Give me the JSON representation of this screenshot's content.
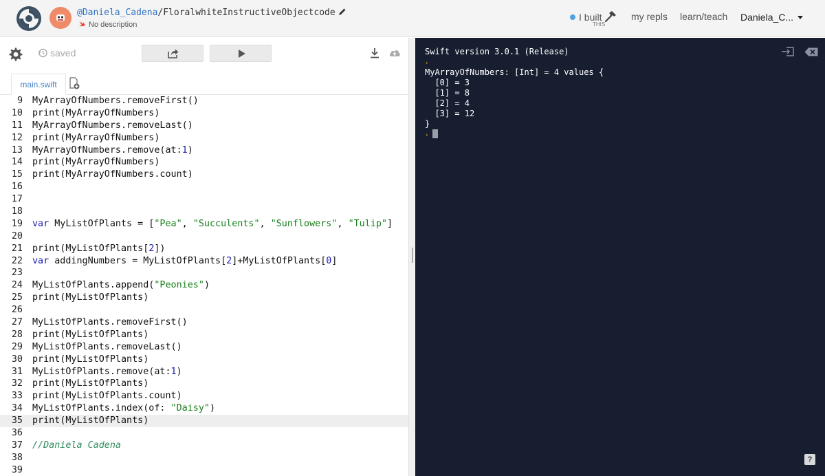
{
  "header": {
    "username": "@Daniela_Cadena",
    "separator": "/",
    "repl_name": "FloralwhiteInstructiveObjectcode",
    "description": "No description",
    "ibuilt_label": "I built",
    "ibuilt_sub": "THIS",
    "nav_myrepls": "my repls",
    "nav_learn": "learn/teach",
    "user_menu": "Daniela_C..."
  },
  "toolbar": {
    "saved_label": "saved"
  },
  "tabs": [
    {
      "label": "main.swift"
    }
  ],
  "editor": {
    "active_line": 35,
    "lines": [
      {
        "num": "9",
        "code": "MyArrayOfNumbers.removeFirst()"
      },
      {
        "num": "10",
        "code": "print(MyArrayOfNumbers)"
      },
      {
        "num": "11",
        "code": "MyArrayOfNumbers.removeLast()"
      },
      {
        "num": "12",
        "code": "print(MyArrayOfNumbers)"
      },
      {
        "num": "13",
        "code": "MyArrayOfNumbers.remove(at:1)"
      },
      {
        "num": "14",
        "code": "print(MyArrayOfNumbers)"
      },
      {
        "num": "15",
        "code": "print(MyArrayOfNumbers.count)"
      },
      {
        "num": "16",
        "code": ""
      },
      {
        "num": "17",
        "code": ""
      },
      {
        "num": "18",
        "code": ""
      },
      {
        "num": "19",
        "code": "var MyListOfPlants = [\"Pea\", \"Succulents\", \"Sunflowers\", \"Tulip\"]"
      },
      {
        "num": "20",
        "code": ""
      },
      {
        "num": "21",
        "code": "print(MyListOfPlants[2])"
      },
      {
        "num": "22",
        "code": "var addingNumbers = MyListOfPlants[2]+MyListOfPlants[0]"
      },
      {
        "num": "23",
        "code": ""
      },
      {
        "num": "24",
        "code": "MyListOfPlants.append(\"Peonies\")"
      },
      {
        "num": "25",
        "code": "print(MyListOfPlants)"
      },
      {
        "num": "26",
        "code": ""
      },
      {
        "num": "27",
        "code": "MyListOfPlants.removeFirst()"
      },
      {
        "num": "28",
        "code": "print(MyListOfPlants)"
      },
      {
        "num": "29",
        "code": "MyListOfPlants.removeLast()"
      },
      {
        "num": "30",
        "code": "print(MyListOfPlants)"
      },
      {
        "num": "31",
        "code": "MyListOfPlants.remove(at:1)"
      },
      {
        "num": "32",
        "code": "print(MyListOfPlants)"
      },
      {
        "num": "33",
        "code": "print(MyListOfPlants.count)"
      },
      {
        "num": "34",
        "code": "MyListOfPlants.index(of: \"Daisy\")"
      },
      {
        "num": "35",
        "code": "print(MyListOfPlants)"
      },
      {
        "num": "36",
        "code": ""
      },
      {
        "num": "37",
        "code": "//Daniela Cadena"
      },
      {
        "num": "38",
        "code": ""
      },
      {
        "num": "39",
        "code": ""
      }
    ]
  },
  "console": {
    "version": "Swift version 3.0.1 (Release)",
    "prompt_symbol": "›",
    "output": [
      "MyArrayOfNumbers: [Int] = 4 values {",
      "  [0] = 3",
      "  [1] = 8",
      "  [2] = 4",
      "  [3] = 12",
      "}"
    ],
    "help_label": "?"
  },
  "colors": {
    "accent": "#2f72c4",
    "console_bg": "#161e30",
    "prompt": "#f0a030",
    "avatar": "#f08b6a"
  }
}
